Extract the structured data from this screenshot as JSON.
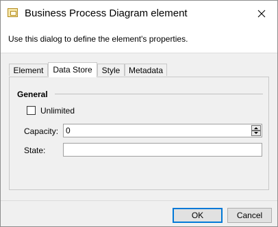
{
  "window": {
    "title": "Business Process Diagram element",
    "instructions": "Use this dialog to define the element's properties."
  },
  "tabs": [
    {
      "label": "Element"
    },
    {
      "label": "Data Store",
      "active": true
    },
    {
      "label": "Style"
    },
    {
      "label": "Metadata"
    }
  ],
  "group": {
    "title": "General"
  },
  "unlimited": {
    "label": "Unlimited",
    "checked": false
  },
  "capacity": {
    "label": "Capacity:",
    "value": "0"
  },
  "state": {
    "label": "State:",
    "value": ""
  },
  "buttons": {
    "ok": "OK",
    "cancel": "Cancel"
  },
  "colors": {
    "default_button_border": "#0078d7",
    "dialog_bg": "#f0f0f0"
  }
}
